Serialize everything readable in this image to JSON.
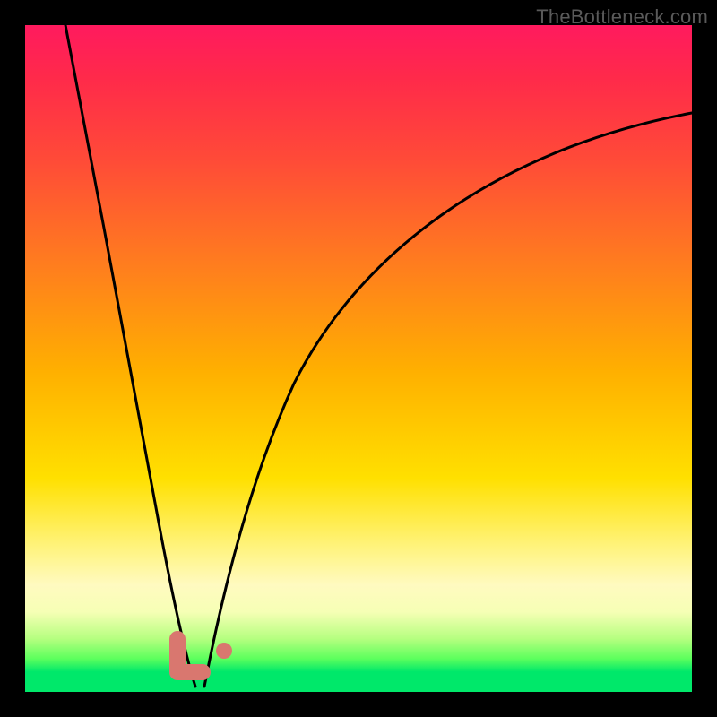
{
  "watermark": "TheBottleneck.com",
  "colors": {
    "frame": "#000000",
    "curve": "#000000",
    "marker": "#d9776f",
    "gradient_top": "#ff1a5e",
    "gradient_bottom": "#00e86a"
  },
  "chart_data": {
    "type": "line",
    "title": "",
    "xlabel": "",
    "ylabel": "",
    "xlim": [
      0,
      100
    ],
    "ylim": [
      0,
      100
    ],
    "series": [
      {
        "name": "left-curve",
        "x": [
          6,
          8,
          10,
          12,
          14,
          16,
          18,
          20,
          22,
          23,
          24,
          24.5,
          25,
          25.5
        ],
        "y": [
          100,
          90,
          79,
          68,
          57,
          46,
          36,
          26,
          16,
          11,
          7,
          4,
          2,
          0
        ]
      },
      {
        "name": "right-curve",
        "x": [
          26,
          27,
          29,
          32,
          36,
          41,
          47,
          54,
          62,
          71,
          81,
          91,
          100
        ],
        "y": [
          0,
          4,
          11,
          21,
          33,
          44,
          54,
          62,
          69,
          75,
          80,
          84,
          87
        ]
      }
    ],
    "annotations": [
      {
        "name": "L-marker",
        "shape": "L",
        "x": 24,
        "y": 3
      },
      {
        "name": "dot-marker",
        "shape": "dot",
        "x": 29,
        "y": 6
      }
    ],
    "gradient_bands": [
      {
        "pct": 0,
        "color": "#ff1a5e"
      },
      {
        "pct": 35,
        "color": "#ff7a20"
      },
      {
        "pct": 68,
        "color": "#ffe000"
      },
      {
        "pct": 88,
        "color": "#f6ffb5"
      },
      {
        "pct": 97,
        "color": "#00e86a"
      }
    ]
  }
}
